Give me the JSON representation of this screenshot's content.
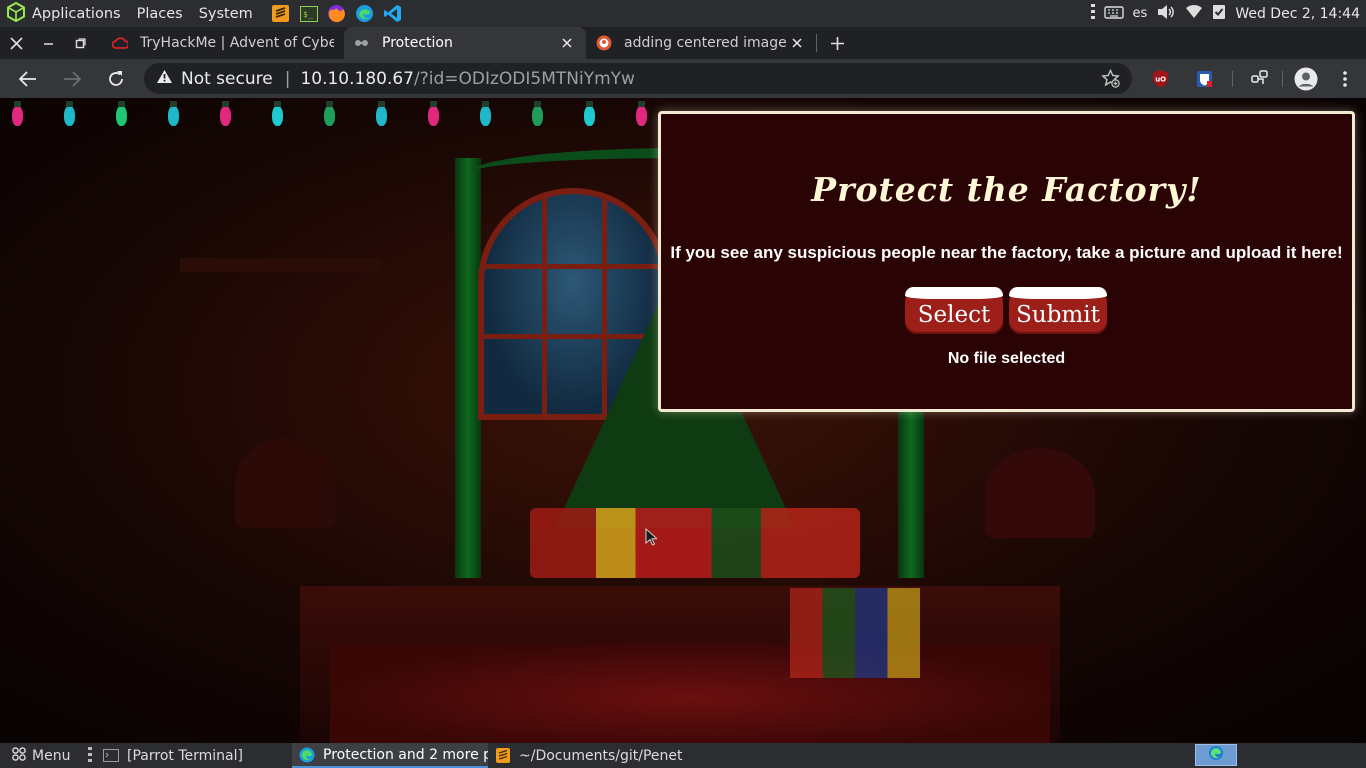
{
  "system_panel": {
    "applications_label": "Applications",
    "places_label": "Places",
    "system_label": "System",
    "keyboard_layout": "es",
    "clock": "Wed Dec  2, 14:44"
  },
  "tabs": [
    {
      "title": "TryHackMe | Advent of Cyber",
      "favicon": "tryhackme-icon"
    },
    {
      "title": "Protection",
      "favicon": "page-icon",
      "active": true
    },
    {
      "title": "adding centered image to",
      "favicon": "duckduckgo-icon"
    }
  ],
  "address_bar": {
    "security_label": "Not secure",
    "host": "10.10.180.67",
    "path": "/?id=ODIzODI5MTNiYmYw"
  },
  "page": {
    "title": "Protect the Factory!",
    "instruction": "If you see any suspicious people near the factory, take a picture and upload it here!",
    "select_label": "Select",
    "submit_label": "Submit",
    "file_status": "No file selected"
  },
  "taskbar": {
    "menu_label": "Menu",
    "items": [
      {
        "label": "[Parrot Terminal]",
        "icon": "terminal-icon"
      },
      {
        "label": "Protection and 2 more p...",
        "icon": "edge-icon",
        "active": true
      },
      {
        "label": "~/Documents/git/Penet...",
        "icon": "sublime-icon"
      }
    ]
  },
  "colors": {
    "card_background": "#2a0304",
    "card_border": "#f4ead2",
    "button_red": "#9c1f1a",
    "chrome_dark": "#202124",
    "chrome_toolbar": "#35363a"
  }
}
